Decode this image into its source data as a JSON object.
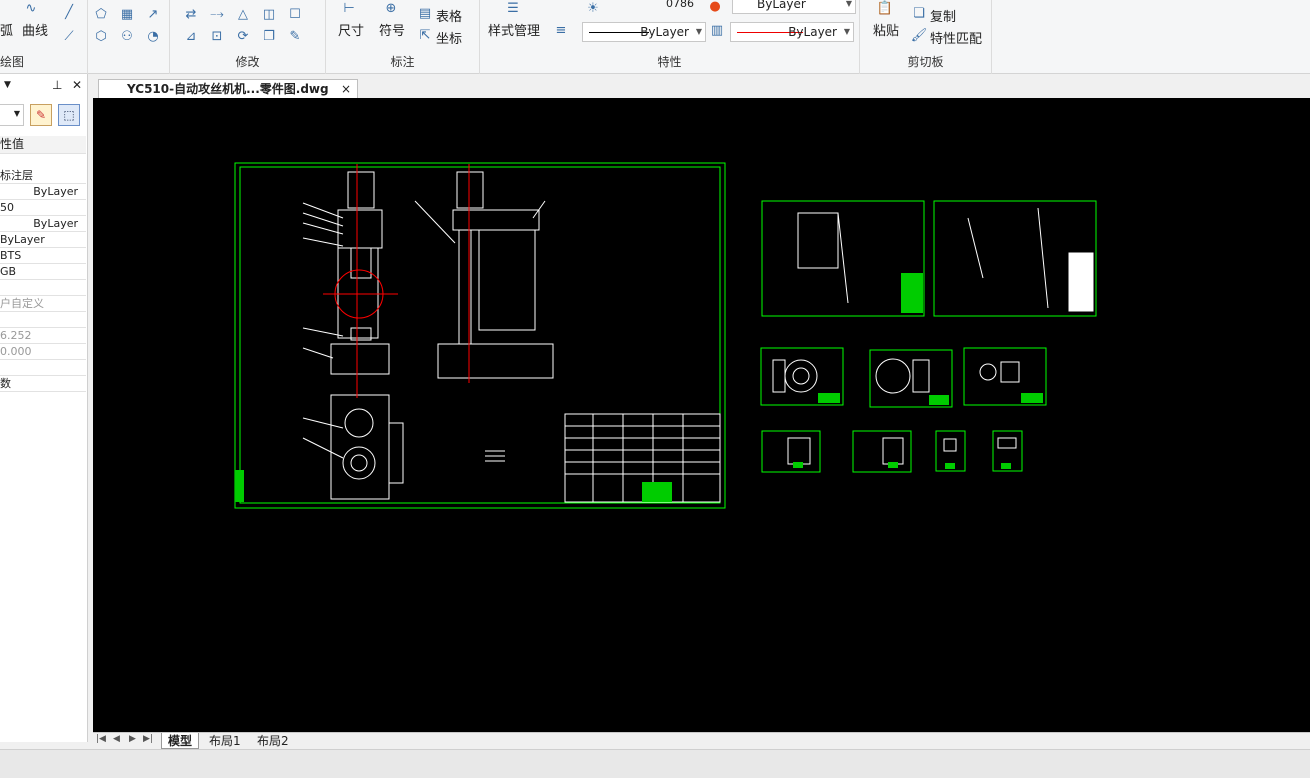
{
  "ribbon": {
    "draw": {
      "label": "绘图",
      "partial_left": "弧",
      "curve": "曲线"
    },
    "modify": {
      "label": "修改"
    },
    "annotate": {
      "label": "标注",
      "dimension": "尺寸",
      "symbol": "符号",
      "table": "表格",
      "coordinate": "坐标"
    },
    "properties": {
      "label": "特性",
      "style_manager": "样式管理",
      "layer_value": "0786",
      "color_value": "ByLayer",
      "linetype_value": "ByLayer",
      "lineweight_value": "ByLayer"
    },
    "clipboard": {
      "label": "剪切板",
      "paste": "粘贴",
      "copy": "复制",
      "match_props": "特性匹配"
    }
  },
  "left_panel": {
    "header": "性值",
    "rows": [
      "标注层",
      "ByLayer",
      "50",
      "ByLayer",
      "ByLayer",
      "BTS",
      "GB",
      "",
      "户自定义",
      "",
      "6.252",
      "0.000",
      "",
      "数"
    ]
  },
  "document": {
    "tab_title": "YC510-自动攻丝机机...零件图.dwg",
    "close": "×"
  },
  "layout_tabs": [
    "模型",
    "布局1",
    "布局2"
  ],
  "colors": {
    "canvas": "#000000",
    "frame": "#00ff00",
    "line": "#ffffff",
    "centerline": "#ff0000"
  }
}
